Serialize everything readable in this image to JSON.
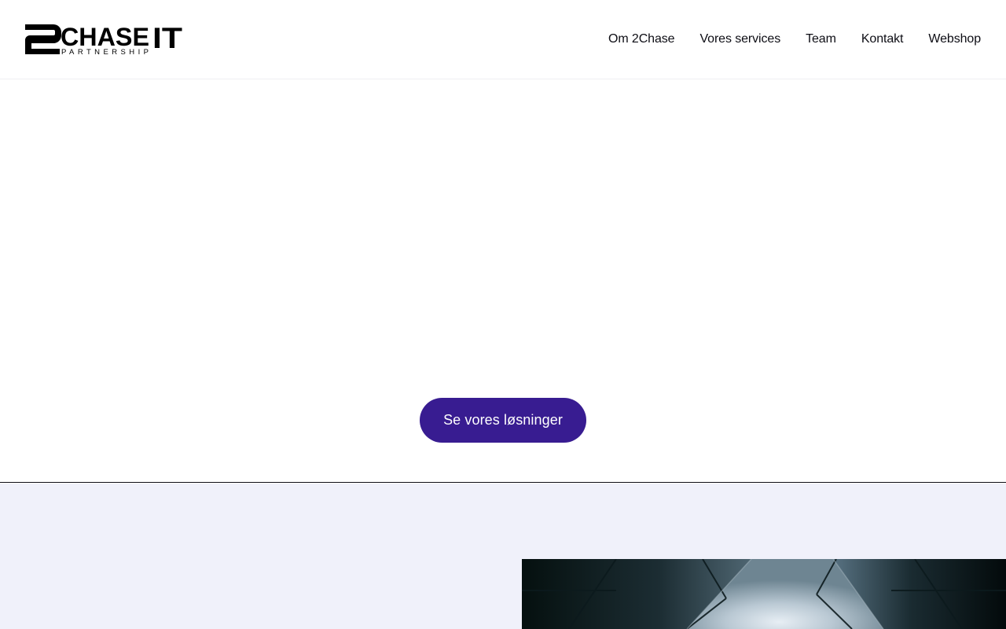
{
  "header": {
    "logo": {
      "main_text": "CHASE",
      "suffix_text": "IT",
      "sub_text": "PARTNERSHIP",
      "mark": "2"
    },
    "nav": [
      {
        "label": "Om 2Chase"
      },
      {
        "label": "Vores services"
      },
      {
        "label": "Team"
      },
      {
        "label": "Kontakt"
      },
      {
        "label": "Webshop"
      }
    ]
  },
  "hero": {
    "cta_label": "Se vores løsninger",
    "cta_color": "#381c91"
  },
  "about": {
    "background_color": "#f0f1fa",
    "image": "building-skyward-photo"
  }
}
